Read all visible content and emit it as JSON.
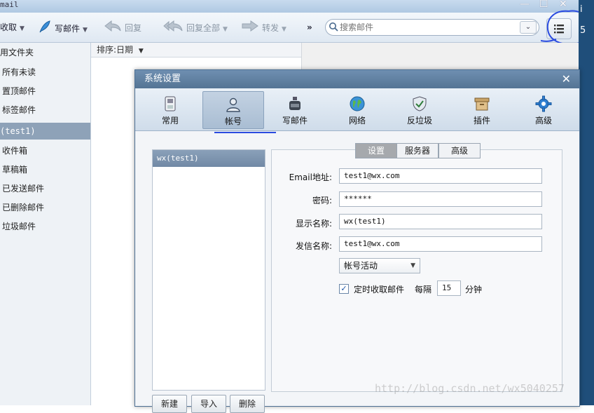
{
  "window": {
    "title": "mail",
    "minimize_glyph": "—",
    "maximize_glyph": "☐",
    "close_glyph": "✕"
  },
  "toolbar": {
    "receive_label": "收取",
    "compose_label": "写邮件",
    "reply_label": "回复",
    "reply_all_label": "回复全部",
    "forward_label": "转发",
    "more_label": "»",
    "search_placeholder": "搜索邮件"
  },
  "sidebar": {
    "items": [
      {
        "label": "用文件夹"
      },
      {
        "label": "所有未读"
      },
      {
        "label": "置顶邮件"
      },
      {
        "label": "标签邮件"
      },
      {
        "label": "(test1)"
      },
      {
        "label": "收件箱"
      },
      {
        "label": "草稿箱"
      },
      {
        "label": "已发送邮件"
      },
      {
        "label": "已删除邮件"
      },
      {
        "label": "垃圾邮件"
      }
    ]
  },
  "list": {
    "sort_label": "排序:日期"
  },
  "right_edge": {
    "chars": [
      "i",
      "5"
    ]
  },
  "dialog": {
    "title": "系统设置",
    "close_glyph": "✕",
    "tabs": [
      {
        "label": "常用",
        "icon": "phone-icon"
      },
      {
        "label": "帐号",
        "icon": "person-icon"
      },
      {
        "label": "写邮件",
        "icon": "ink-bottle-icon"
      },
      {
        "label": "网络",
        "icon": "globe-icon"
      },
      {
        "label": "反垃圾",
        "icon": "shield-icon"
      },
      {
        "label": "插件",
        "icon": "box-icon"
      },
      {
        "label": "高级",
        "icon": "gear-icon"
      }
    ],
    "active_tab": "帐号",
    "accounts": [
      {
        "label": "wx(test1)"
      }
    ],
    "buttons": {
      "new": "新建",
      "import": "导入",
      "delete": "删除"
    },
    "subtabs": [
      "设置",
      "服务器",
      "高级"
    ],
    "form": {
      "email_label": "Email地址:",
      "email_value": "test1@wx.com",
      "password_label": "密码:",
      "password_value": "******",
      "display_name_label": "显示名称:",
      "display_name_value": "wx(test1)",
      "sender_name_label": "发信名称:",
      "sender_name_value": "test1@wx.com",
      "status_select": "帐号活动",
      "timer_checkbox_label": "定时收取邮件",
      "timer_checked": true,
      "every_label": "每隔",
      "interval_value": "15",
      "minute_label": "分钟"
    }
  },
  "watermark": "http://blog.csdn.net/wx5040257",
  "colors": {
    "accent": "#5a7a9a",
    "selection": "#8ea2b8",
    "annotation": "#2a4be0"
  }
}
